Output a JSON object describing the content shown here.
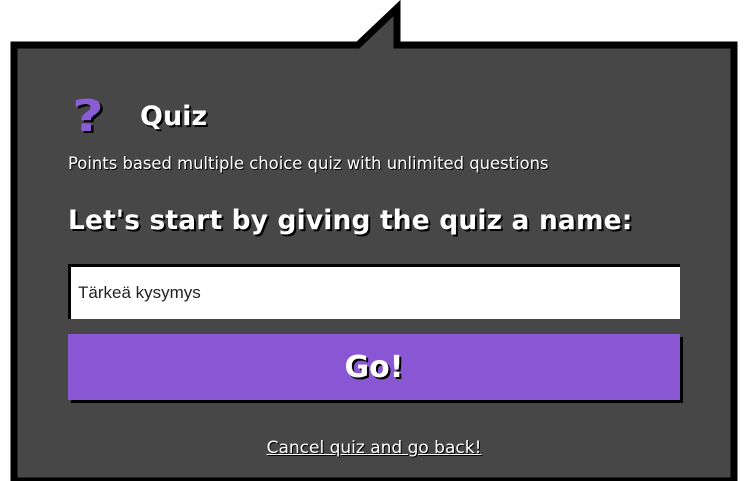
{
  "dialog": {
    "icon": "question-mark-icon",
    "icon_glyph": "?",
    "title": "Quiz",
    "description": "Points based multiple choice quiz with unlimited questions",
    "prompt": "Let's start by giving the quiz a name:",
    "name_input_value": "Tärkeä kysymys",
    "go_label": "Go!",
    "cancel_label": "Cancel quiz and go back!"
  },
  "colors": {
    "panel_background": "#474747",
    "panel_border": "#000000",
    "accent": "#8a57d4",
    "icon": "#8b5cd6",
    "text": "#ffffff",
    "input_background": "#ffffff"
  }
}
